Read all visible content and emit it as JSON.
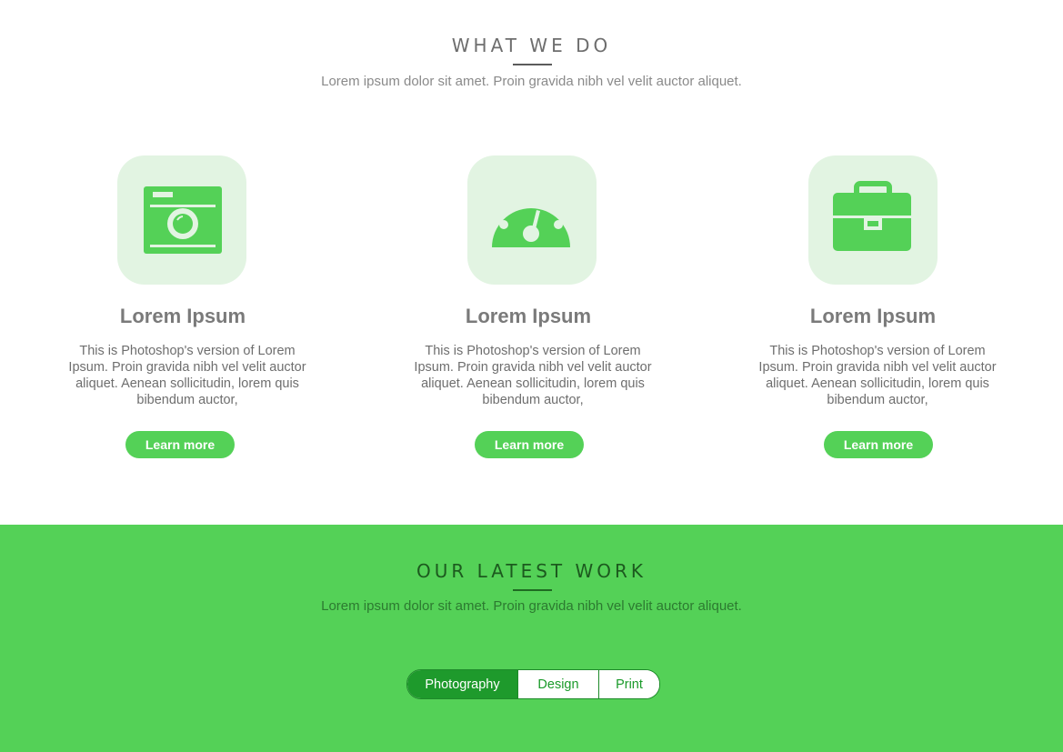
{
  "services": {
    "title": "WHAT WE DO",
    "subtitle": "Lorem ipsum dolor sit amet. Proin gravida nibh vel velit auctor aliquet.",
    "cards": [
      {
        "icon": "camera-icon",
        "title": "Lorem Ipsum",
        "text": "This is Photoshop's version  of Lorem Ipsum. Proin gravida nibh vel velit auctor aliquet. Aenean sollicitudin, lorem quis bibendum auctor,",
        "button": "Learn more"
      },
      {
        "icon": "dashboard-icon",
        "title": "Lorem Ipsum",
        "text": "This is Photoshop's version  of Lorem Ipsum. Proin gravida nibh vel velit auctor aliquet. Aenean sollicitudin, lorem quis bibendum auctor,",
        "button": "Learn more"
      },
      {
        "icon": "briefcase-icon",
        "title": "Lorem Ipsum",
        "text": "This is Photoshop's version  of Lorem Ipsum. Proin gravida nibh vel velit auctor aliquet. Aenean sollicitudin, lorem quis bibendum auctor,",
        "button": "Learn more"
      }
    ]
  },
  "work": {
    "title": "OUR LATEST WORK",
    "subtitle": "Lorem ipsum dolor sit amet. Proin gravida nibh vel velit auctor aliquet.",
    "filters": [
      {
        "label": "Photography",
        "active": true
      },
      {
        "label": "Design",
        "active": false
      },
      {
        "label": "Print",
        "active": false
      }
    ]
  },
  "colors": {
    "accent": "#54d157",
    "accent_dark": "#1e9a2c",
    "icon_bg": "#e2f4e2"
  }
}
